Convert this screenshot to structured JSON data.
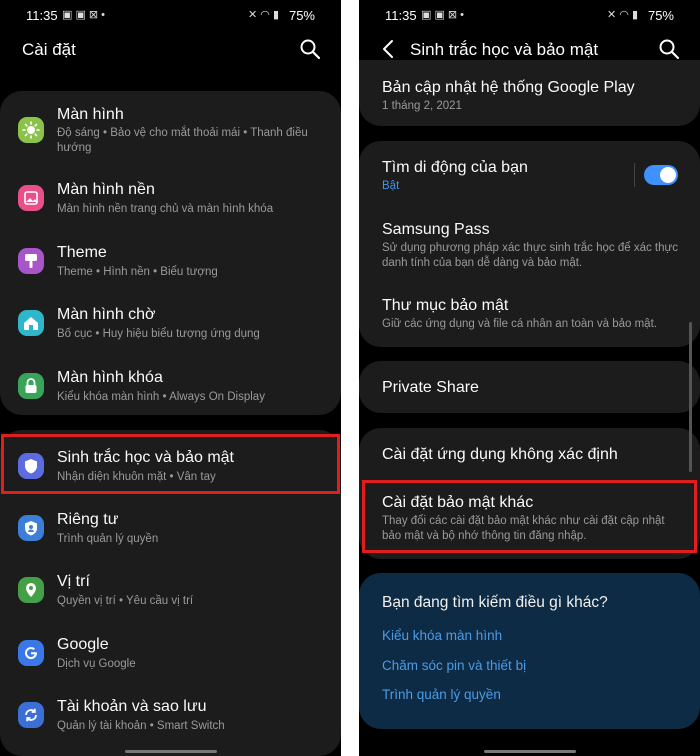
{
  "status": {
    "time": "11:35",
    "battery": "75%"
  },
  "left": {
    "title": "Cài đặt",
    "items": [
      {
        "title": "Màn hình",
        "subtitle": "Độ sáng  •  Bảo vệ cho mắt thoải mái  •  Thanh điều hướng",
        "icon": "sun-icon",
        "color": "#8bc34a"
      },
      {
        "title": "Màn hình nền",
        "subtitle": "Màn hình nền trang chủ và màn hình khóa",
        "icon": "picture-icon",
        "color": "#e8508a"
      },
      {
        "title": "Theme",
        "subtitle": "Theme  •  Hình nền  •  Biểu tượng",
        "icon": "brush-icon",
        "color": "#a855c9"
      },
      {
        "title": "Màn hình chờ",
        "subtitle": "Bố cục  •  Huy hiệu biểu tượng ứng dụng",
        "icon": "home-icon",
        "color": "#2fb6c8"
      },
      {
        "title": "Màn hình khóa",
        "subtitle": "Kiểu khóa màn hình  •  Always On Display",
        "icon": "lock-icon",
        "color": "#3aa35a"
      },
      {
        "title": "Sinh trắc học và bảo mật",
        "subtitle": "Nhận diện khuôn mặt  •  Vân tay",
        "icon": "shield-icon",
        "color": "#5d6be0"
      },
      {
        "title": "Riêng tư",
        "subtitle": "Trình quản lý quyền",
        "icon": "privacy-icon",
        "color": "#3c7fd8"
      },
      {
        "title": "Vị trí",
        "subtitle": "Quyền vị trí  •  Yêu cầu vị trí",
        "icon": "location-pin-icon",
        "color": "#43a047"
      },
      {
        "title": "Google",
        "subtitle": "Dịch vụ Google",
        "icon": "google-icon",
        "color": "#3b78e7"
      },
      {
        "title": "Tài khoản và sao lưu",
        "subtitle": "Quản lý tài khoản  •  Smart Switch",
        "icon": "sync-icon",
        "color": "#3c6fd6"
      }
    ]
  },
  "right": {
    "title": "Sinh trắc học và bảo mật",
    "items": [
      {
        "title": "Bản cập nhật hệ thống Google Play",
        "subtitle": "1 tháng 2, 2021"
      },
      {
        "title": "Tìm di động của bạn",
        "subtitle": "Bật"
      },
      {
        "title": "Samsung Pass",
        "subtitle": "Sử dụng phương pháp xác thực sinh trắc học để xác thực danh tính của bạn dễ dàng và bảo mật."
      },
      {
        "title": "Thư mục bảo mật",
        "subtitle": "Giữ các ứng dụng và file cá nhân an toàn và bảo mật."
      },
      {
        "title": "Private Share"
      },
      {
        "title": "Cài đặt ứng dụng không xác định"
      },
      {
        "title": "Cài đặt bảo mật khác",
        "subtitle": "Thay đổi các cài đặt bảo mật khác như cài đặt cập nhật bảo mật và bộ nhớ thông tin đăng nhập."
      }
    ],
    "suggest": {
      "heading": "Bạn đang tìm kiếm điều gì khác?",
      "links": [
        "Kiểu khóa màn hình",
        "Chăm sóc pin và thiết bị",
        "Trình quản lý quyền"
      ]
    }
  },
  "colors": {
    "highlight": "#e01e1e",
    "toggle": "#3e91ff",
    "link": "#4a9be6"
  }
}
